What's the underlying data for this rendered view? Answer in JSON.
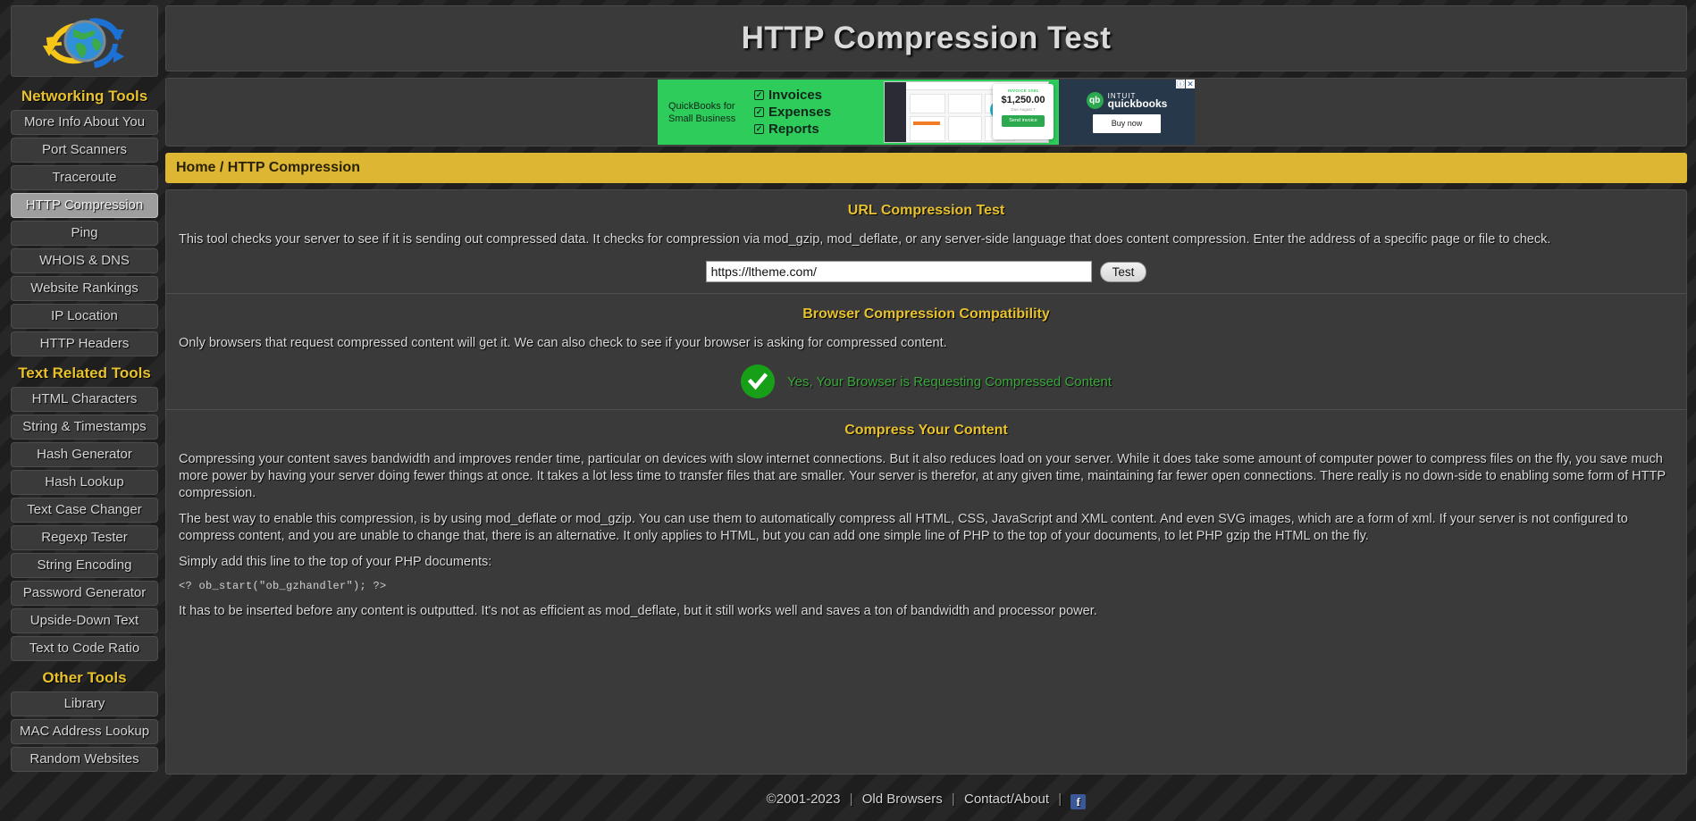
{
  "sidebar": {
    "logo_alt": "globe-refresh-logo",
    "groups": [
      {
        "title": "Networking Tools",
        "items": [
          {
            "label": "More Info About You",
            "active": false
          },
          {
            "label": "Port Scanners",
            "active": false
          },
          {
            "label": "Traceroute",
            "active": false
          },
          {
            "label": "HTTP Compression",
            "active": true
          },
          {
            "label": "Ping",
            "active": false
          },
          {
            "label": "WHOIS & DNS",
            "active": false
          },
          {
            "label": "Website Rankings",
            "active": false
          },
          {
            "label": "IP Location",
            "active": false
          },
          {
            "label": "HTTP Headers",
            "active": false
          }
        ]
      },
      {
        "title": "Text Related Tools",
        "items": [
          {
            "label": "HTML Characters",
            "active": false
          },
          {
            "label": "String & Timestamps",
            "active": false
          },
          {
            "label": "Hash Generator",
            "active": false
          },
          {
            "label": "Hash Lookup",
            "active": false
          },
          {
            "label": "Text Case Changer",
            "active": false
          },
          {
            "label": "Regexp Tester",
            "active": false
          },
          {
            "label": "String Encoding",
            "active": false
          },
          {
            "label": "Password Generator",
            "active": false
          },
          {
            "label": "Upside-Down Text",
            "active": false
          },
          {
            "label": "Text to Code Ratio",
            "active": false
          }
        ]
      },
      {
        "title": "Other Tools",
        "items": [
          {
            "label": "Library",
            "active": false
          },
          {
            "label": "MAC Address Lookup",
            "active": false
          },
          {
            "label": "Random Websites",
            "active": false
          }
        ]
      }
    ]
  },
  "header": {
    "title": "HTTP Compression Test"
  },
  "ad": {
    "tagline": "QuickBooks for Small Business",
    "features": [
      "Invoices",
      "Expenses",
      "Reports"
    ],
    "check_glyph": "✓",
    "invoice_label": "INVOICE 1081",
    "invoice_amount": "$1,250.00",
    "invoice_due": "Due August 7",
    "invoice_button": "Send invoice",
    "brand_mark": "qb",
    "brand_line1": "INTUIT",
    "brand_line2": "quickbooks",
    "cta": "Buy now",
    "info_glyph": "ⓘ",
    "close_glyph": "✕",
    "green": "#2ecc5b",
    "navy": "#27384a"
  },
  "breadcrumb": {
    "text": "Home / HTTP Compression"
  },
  "url_test": {
    "heading": "URL Compression Test",
    "description": "This tool checks your server to see if it is sending out compressed data. It checks for compression via mod_gzip, mod_deflate, or any server-side language that does content compression. Enter the address of a specific page or file to check.",
    "input_value": "https://ltheme.com/",
    "input_placeholder": "",
    "button_label": "Test"
  },
  "browser_compat": {
    "heading": "Browser Compression Compatibility",
    "description": "Only browsers that request compressed content will get it. We can also check to see if your browser is asking for compressed content.",
    "status_text": "Yes, Your Browser is Requesting Compressed Content",
    "status_color": "#3ba83b",
    "check_glyph": "✔"
  },
  "compress_content": {
    "heading": "Compress Your Content",
    "paragraph1": "Compressing your content saves bandwidth and improves render time, particular on devices with slow internet connections. But it also reduces load on your server. While it does take some amount of computer power to compress files on the fly, you save much more power by having your server doing fewer things at once. It takes a lot less time to transfer files that are smaller. Your server is therefor, at any given time, maintaining far fewer open connections. There really is no down-side to enabling some form of HTTP compression.",
    "paragraph2": "The best way to enable this compression, is by using mod_deflate or mod_gzip. You can use them to automatically compress all HTML, CSS, JavaScript and XML content. And even SVG images, which are a form of xml. If your server is not configured to compress content, and you are unable to change that, there is an alternative. It only applies to HTML, but you can add one simple line of PHP to the top of your documents, to let PHP gzip the HTML on the fly.",
    "paragraph3": "Simply add this line to the top of your PHP documents:",
    "code": "<? ob_start(\"ob_gzhandler\"); ?>",
    "paragraph4": "It has to be inserted before any content is outputted. It's not as efficient as mod_deflate, but it still works well and saves a ton of bandwidth and processor power."
  },
  "footer": {
    "copyright": "©2001-2023",
    "link_old_browsers": "Old Browsers",
    "link_contact": "Contact/About",
    "facebook_glyph": "f",
    "separator": "|"
  },
  "colors": {
    "accent_yellow": "#e8c22e",
    "breadcrumb_bg": "#ddb633",
    "panel_bg": "#3a3a3a",
    "page_bg": "#222222"
  }
}
